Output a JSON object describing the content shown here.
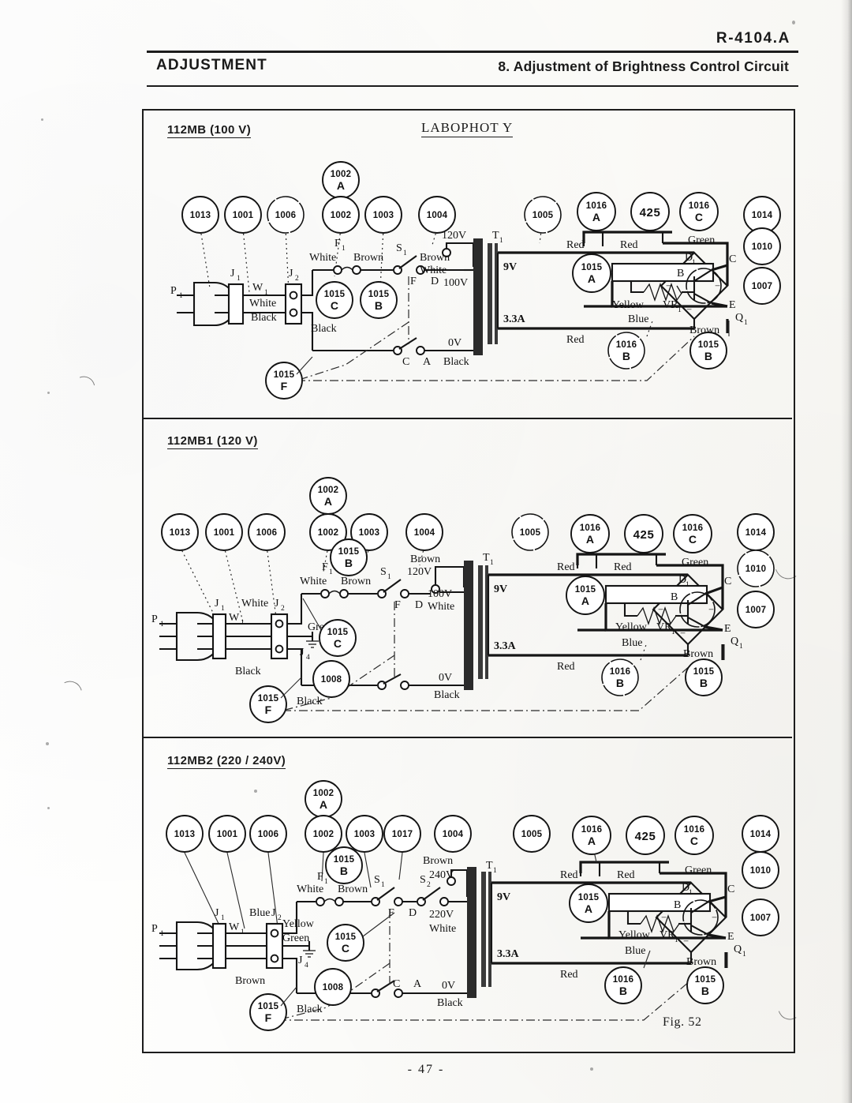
{
  "document": {
    "code": "R-4104.A",
    "header_left": "ADJUSTMENT",
    "header_right": "8. Adjustment of Brightness Control Circuit",
    "model_title": "LABOPHOT Y",
    "figure_caption": "Fig. 52",
    "page_number": "- 47 -"
  },
  "panels": [
    {
      "title": "112MB (100 V)",
      "bubbles_top": [
        "1013",
        "1001",
        "1006",
        "1002",
        "1003",
        "1004"
      ],
      "bubble_stacked": {
        "id": "1002",
        "suffix": "A"
      },
      "bubbles_right": [
        "1005",
        "1016",
        "425",
        "1016",
        "1014",
        "1010",
        "1007"
      ],
      "bubbles_right_suffix": [
        "",
        "A",
        "",
        "C",
        "",
        "",
        ""
      ],
      "bubbles_inner": [
        "1015",
        "1015",
        "1015",
        "1015",
        "1016",
        "1015"
      ],
      "bubbles_inner_suffix": [
        "C",
        "B",
        "F",
        "A",
        "B",
        "B"
      ],
      "plug": "P1",
      "connectors": [
        "J1",
        "W1",
        "J2"
      ],
      "switch": "S1",
      "fuse": "F1",
      "transformer": "T1",
      "rectifier": "D1",
      "potentiometer": "VR1",
      "transistor": "Q1",
      "transistor_terminals": [
        "B",
        "C",
        "E"
      ],
      "switch_terminals": [
        "F",
        "D",
        "C",
        "A"
      ],
      "taps": [
        "120V",
        "100V",
        "0V"
      ],
      "secondary": [
        "9V",
        "3.3A"
      ],
      "wires": [
        "White",
        "Black",
        "Brown",
        "White",
        "Brown",
        "Black",
        "Red",
        "Red",
        "Red",
        "Green",
        "Yellow",
        "Blue",
        "Brown"
      ]
    },
    {
      "title": "112MB1 (120 V)",
      "bubbles_top": [
        "1013",
        "1001",
        "1006",
        "1002",
        "1003",
        "1004"
      ],
      "bubble_stacked": {
        "id": "1002",
        "suffix": "A"
      },
      "bubbles_right": [
        "1005",
        "1016",
        "425",
        "1016",
        "1014",
        "1010",
        "1007"
      ],
      "bubbles_right_suffix": [
        "",
        "A",
        "",
        "C",
        "",
        "",
        ""
      ],
      "bubbles_inner": [
        "1015",
        "1015",
        "1015",
        "1008",
        "1015",
        "1016",
        "1015"
      ],
      "bubbles_inner_suffix": [
        "B",
        "C",
        "F",
        "",
        "A",
        "B",
        "B"
      ],
      "plug": "P1",
      "connectors": [
        "J1",
        "W1",
        "J2",
        "J4"
      ],
      "switch": "S1",
      "fuse": "F1",
      "transformer": "T1",
      "rectifier": "D1",
      "potentiometer": "VR1",
      "transistor": "Q1",
      "transistor_terminals": [
        "B",
        "C",
        "E"
      ],
      "switch_terminals": [
        "F",
        "D"
      ],
      "taps": [
        "120V",
        "100V",
        "0V"
      ],
      "secondary": [
        "9V",
        "3.3A"
      ],
      "wires": [
        "White",
        "Black",
        "Black",
        "Green",
        "Brown",
        "White",
        "Red",
        "Red",
        "Red",
        "Green",
        "Yellow",
        "Blue",
        "Brown"
      ]
    },
    {
      "title": "112MB2 (220 / 240V)",
      "bubbles_top": [
        "1013",
        "1001",
        "1006",
        "1002",
        "1003",
        "1017",
        "1004"
      ],
      "bubble_stacked": {
        "id": "1002",
        "suffix": "A"
      },
      "bubbles_right": [
        "1005",
        "1016",
        "425",
        "1016",
        "1014",
        "1010",
        "1007"
      ],
      "bubbles_right_suffix": [
        "",
        "A",
        "",
        "C",
        "",
        "",
        ""
      ],
      "bubbles_inner": [
        "1015",
        "1015",
        "1015",
        "1008",
        "1015",
        "1016",
        "1015"
      ],
      "bubbles_inner_suffix": [
        "B",
        "C",
        "F",
        "",
        "A",
        "B",
        "B"
      ],
      "plug": "P1",
      "connectors": [
        "J1",
        "W1",
        "J2",
        "J4"
      ],
      "switches": [
        "S1",
        "S2"
      ],
      "fuse": "F1",
      "transformer": "T1",
      "rectifier": "D1",
      "potentiometer": "VR1",
      "transistor": "Q1",
      "transistor_terminals": [
        "B",
        "C",
        "E"
      ],
      "switch_terminals": [
        "F",
        "D",
        "C",
        "A"
      ],
      "taps": [
        "240V",
        "220V",
        "0V"
      ],
      "secondary": [
        "9V",
        "3.3A"
      ],
      "wires": [
        "White",
        "Blue",
        "Yellow",
        "Green",
        "Brown",
        "Black",
        "Black",
        "Brown",
        "White",
        "Red",
        "Red",
        "Red",
        "Green",
        "Yellow",
        "Blue",
        "Brown"
      ]
    }
  ],
  "labels": {
    "white": "White",
    "black": "Black",
    "brown": "Brown",
    "red": "Red",
    "green": "Green",
    "yellow": "Yellow",
    "blue": "Blue"
  }
}
